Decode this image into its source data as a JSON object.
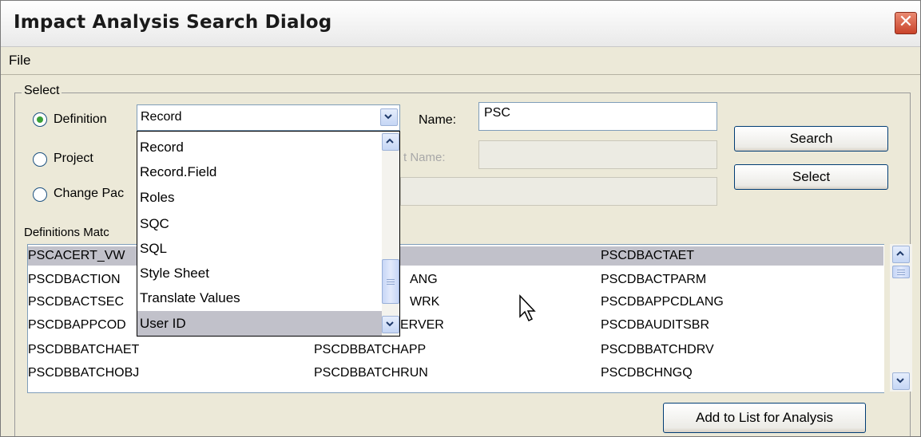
{
  "window": {
    "title": "Impact Analysis Search Dialog",
    "close_glyph": "✕"
  },
  "menu": {
    "file": "File"
  },
  "select_group": {
    "legend": "Select",
    "radio_definition": "Definition",
    "radio_project": "Project",
    "radio_change_package": "Change Pac",
    "selected_radio": "Definition",
    "definition_type_value": "Record",
    "name_label": "Name:",
    "name_value": "PSC",
    "project_name_label": "t Name:",
    "search_button": "Search",
    "select_button": "Select"
  },
  "definitions": {
    "label": "Definitions Matc",
    "rows": [
      [
        "PSCACERT_VW",
        "",
        "PSCDBACTAET"
      ],
      [
        "PSCDBACTION",
        "ANG",
        "PSCDBACTPARM"
      ],
      [
        "PSCDBACTSEC",
        "WRK",
        "PSCDBAPPCDLANG"
      ],
      [
        "PSCDBAPPCOD",
        "ERVER",
        "PSCDBAUDITSBR"
      ],
      [
        "PSCDBBATCHAET",
        "PSCDBBATCHAPP",
        "PSCDBBATCHDRV"
      ],
      [
        "PSCDBBATCHOBJ",
        "PSCDBBATCHRUN",
        "PSCDBCHNGQ"
      ]
    ],
    "selected_row": 0
  },
  "dropdown": {
    "items": [
      "Record",
      "Record.Field",
      "Roles",
      "SQC",
      "SQL",
      "Style Sheet",
      "Translate Values",
      "User ID"
    ],
    "highlighted": "User ID"
  },
  "actions": {
    "add_to_list": "Add to List for Analysis"
  },
  "icons": {
    "close": "close-icon",
    "combo_arrow": "chevron-down-icon",
    "scroll_up": "chevron-up-icon",
    "scroll_down": "chevron-down-icon",
    "cursor": "mouse-pointer-icon"
  },
  "colors": {
    "window_bg": "#ece9d8",
    "close_button": "#c9432a",
    "selection": "#c1c1ca",
    "button_border": "#003c74",
    "radio_dot": "#3aa038"
  }
}
